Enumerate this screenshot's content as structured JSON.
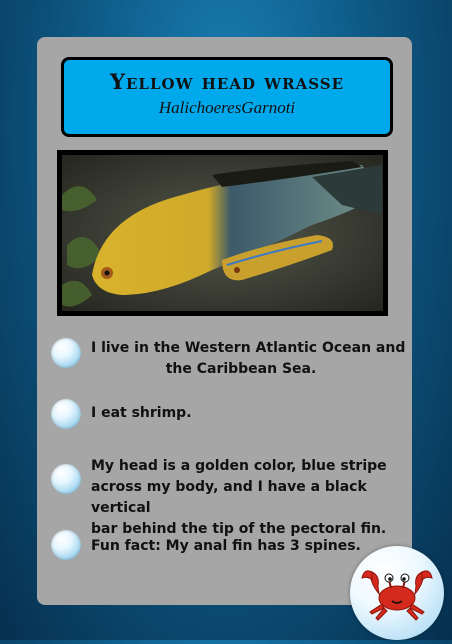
{
  "title": "Yellow head wrasse",
  "scientific_name": "HalichoeresGarnoti",
  "photo": {
    "subject": "yellow head wrasse fish photo"
  },
  "facts": [
    {
      "lines": [
        "I live in the Western Atlantic Ocean and",
        "the Caribbean Sea."
      ]
    },
    {
      "lines": [
        "I eat shrimp."
      ]
    },
    {
      "lines": [
        "My head is a golden color, blue stripe",
        "across my body, and I have a black vertical",
        "bar behind the tip of the pectoral fin."
      ]
    },
    {
      "lines": [
        "Fun fact: My anal fin has 3 spines."
      ]
    }
  ],
  "icons": {
    "bullet": "bubble-icon",
    "mascot": "crab-icon"
  },
  "colors": {
    "title_box": "#00a8ec",
    "card": "#a6a6a6",
    "crab": "#d42a1e"
  }
}
